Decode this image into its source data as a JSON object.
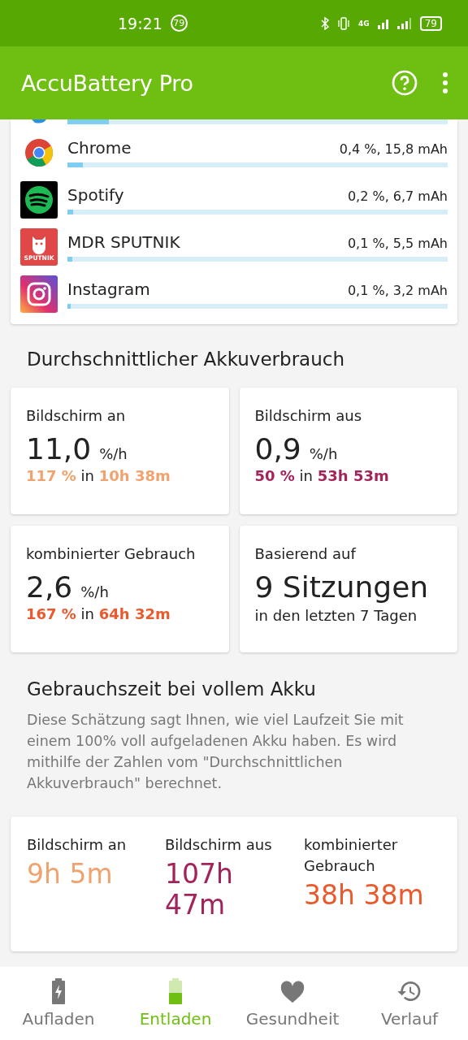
{
  "status_bar": {
    "time": "19:21",
    "badge": "79",
    "network": "4G",
    "battery": "79"
  },
  "app_bar": {
    "title": "AccuBattery Pro"
  },
  "apps": [
    {
      "kind": "partial",
      "level": 0.11
    },
    {
      "kind": "chrome",
      "name": "Chrome",
      "value": "0,4 %, 15,8 mAh",
      "level": 0.04
    },
    {
      "kind": "spotify",
      "name": "Spotify",
      "value": "0,2 %, 6,7 mAh",
      "level": 0.015
    },
    {
      "kind": "sputnik",
      "name": "MDR SPUTNIK",
      "value": "0,1 %, 5,5 mAh",
      "level": 0.012,
      "icon_text": "SPUTNIK"
    },
    {
      "kind": "instagram",
      "name": "Instagram",
      "value": "0,1 %, 3,2 mAh",
      "level": 0.008
    }
  ],
  "average": {
    "title": "Durchschnittlicher Akkuverbrauch",
    "cards": [
      {
        "kind": "rate",
        "label": "Bildschirm an",
        "value": "11,0",
        "unit": "%/h",
        "percent": "117 %",
        "in": "in",
        "duration": "10h 38m",
        "color": "#f0a36e"
      },
      {
        "kind": "rate",
        "label": "Bildschirm aus",
        "value": "0,9",
        "unit": "%/h",
        "percent": "50 %",
        "in": "in",
        "duration": "53h 53m",
        "color": "#a3235b"
      },
      {
        "kind": "rate",
        "label": "kombinierter Gebrauch",
        "value": "2,6",
        "unit": "%/h",
        "percent": "167 %",
        "in": "in",
        "duration": "64h 32m",
        "color": "#e95a2c"
      },
      {
        "kind": "sessions",
        "label": "Basierend auf",
        "value": "9 Sitzungen",
        "note": "in den letzten 7 Tagen"
      }
    ]
  },
  "full": {
    "title": "Gebrauchszeit bei vollem Akku",
    "description": "Diese Schätzung sagt Ihnen, wie viel Laufzeit Sie mit einem 100% voll aufgeladenen Akku haben. Es wird mithilfe der Zahlen vom \"Durchschnittlichen Akkuverbrauch\" berechnet.",
    "columns": [
      {
        "label": "Bildschirm an",
        "value": "9h 5m",
        "color": "#f0a36e"
      },
      {
        "label": "Bildschirm aus",
        "value": "107h 47m",
        "color": "#a3235b"
      },
      {
        "label": "kombinierter Gebrauch",
        "value": "38h 38m",
        "color": "#e95a2c"
      }
    ]
  },
  "nav": [
    {
      "kind": "charge",
      "label": "Aufladen",
      "selected": false
    },
    {
      "kind": "discharge",
      "label": "Entladen",
      "selected": true
    },
    {
      "kind": "health",
      "label": "Gesundheit",
      "selected": false
    },
    {
      "kind": "history",
      "label": "Verlauf",
      "selected": false
    }
  ]
}
